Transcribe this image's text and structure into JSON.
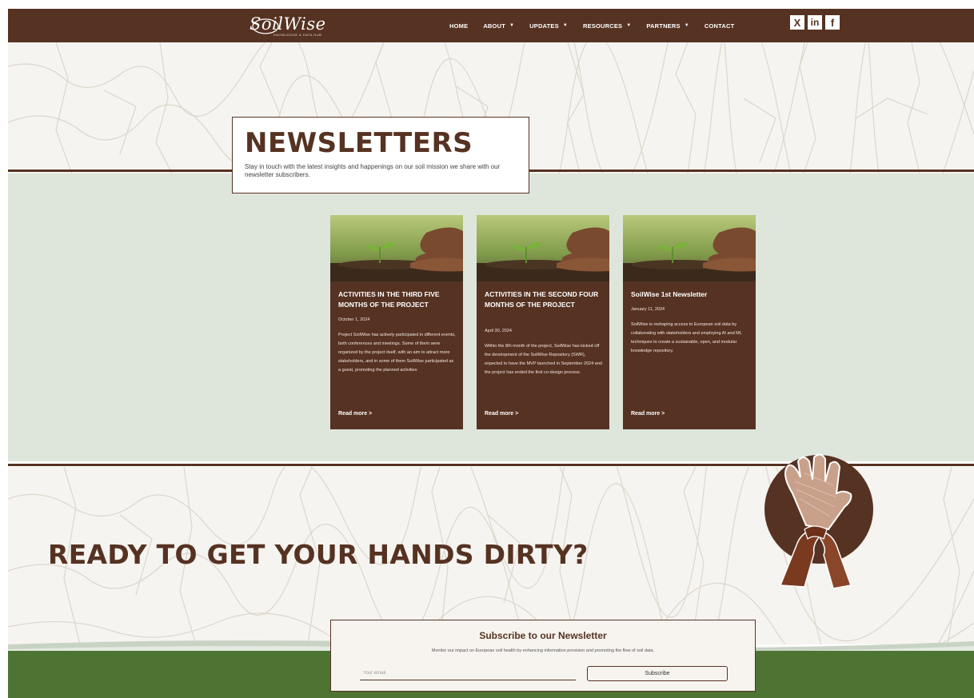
{
  "header": {
    "logo_text": "SoilWise",
    "logo_tagline": "KNOWLEDGE & DATA HUB",
    "nav": [
      {
        "label": "HOME",
        "has_caret": false
      },
      {
        "label": "ABOUT",
        "has_caret": true
      },
      {
        "label": "UPDATES",
        "has_caret": true
      },
      {
        "label": "RESOURCES",
        "has_caret": true
      },
      {
        "label": "PARTNERS",
        "has_caret": true
      },
      {
        "label": "CONTACT",
        "has_caret": false
      }
    ],
    "caret": "▼",
    "socials": [
      {
        "icon": "x-icon",
        "glyph": "X"
      },
      {
        "icon": "linkedin-icon",
        "glyph": "in"
      },
      {
        "icon": "facebook-icon",
        "glyph": "f"
      }
    ]
  },
  "hero": {
    "title": "NEWSLETTERS",
    "subtitle": "Stay in touch with the latest insights and happenings on our soil mission we share with our newsletter subscribers."
  },
  "cards": [
    {
      "title": "ACTIVITIES IN THE THIRD FIVE MONTHS OF THE PROJECT",
      "date": "October 1, 2024",
      "excerpt": "Project SoilWise has actively participated in different events, both conferences and meetings. Some of them were organized by the project itself, with an aim to attract more stakeholders, and in some of them SoilWise participated as a guest, promoting the planned activities",
      "read_more": "Read more >"
    },
    {
      "title": "ACTIVITIES IN THE SECOND FOUR MONTHS OF THE PROJECT",
      "date": "April 30, 2024",
      "excerpt": "Within the 8th month of the project, SoilWise has kicked off the development of the SoilWise Repository (SWR), expected to have the MVP launched in September 2024 and the project has ended the first co-design process.",
      "read_more": "Read more >"
    },
    {
      "title": "SoilWise 1st Newsletter",
      "date": "January 11, 2024",
      "excerpt": "SoilWise is reshaping access to European soil data by collaborating with stakeholders and employing AI and ML techniques to create a sustainable, open, and modular knowledge repository.",
      "read_more": "Read more >"
    }
  ],
  "cta": {
    "title": "READY TO GET YOUR HANDS DIRTY?"
  },
  "subscribe": {
    "title": "Subscribe to our Newsletter",
    "description": "Monitor our impact on European soil health by enhancing information provision and promoting the flow of soil data.",
    "email_placeholder": "Your email",
    "button_label": "Subscribe"
  },
  "colors": {
    "brown": "#563222",
    "sage": "#dee6dc",
    "green": "#4d7433",
    "cream": "#f6f4f0"
  }
}
